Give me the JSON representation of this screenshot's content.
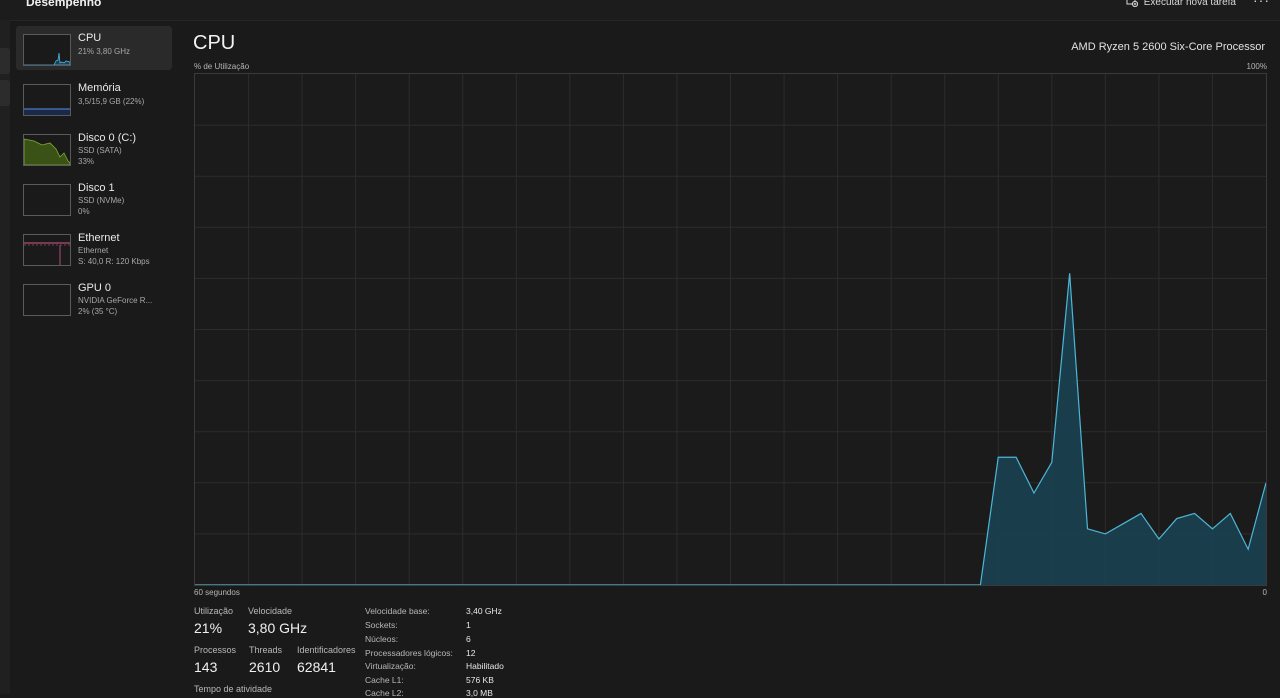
{
  "header": {
    "title": "Desempenho",
    "run_task_label": "Executar nova tarefa",
    "more_label": "···"
  },
  "sidebar": {
    "items": [
      {
        "name": "CPU",
        "sub1": "21% 3,80 GHz",
        "sub2": "",
        "sub3": "",
        "icon": "cpu-graph-icon",
        "color": "#4fb3e8"
      },
      {
        "name": "Memória",
        "sub1": "3,5/15,9 GB (22%)",
        "sub2": "",
        "sub3": "",
        "icon": "memory-graph-icon",
        "color": "#5b8fe0"
      },
      {
        "name": "Disco 0 (C:)",
        "sub1": "SSD (SATA)",
        "sub2": "33%",
        "sub3": "",
        "icon": "disk-graph-icon",
        "color": "#7fae2e"
      },
      {
        "name": "Disco 1",
        "sub1": "SSD (NVMe)",
        "sub2": "0%",
        "sub3": "",
        "icon": "disk-graph-icon",
        "color": "#7fae2e"
      },
      {
        "name": "Ethernet",
        "sub1": "Ethernet",
        "sub2": "S: 40,0  R: 120 Kbps",
        "sub3": "",
        "icon": "network-graph-icon",
        "color": "#d55a8a"
      },
      {
        "name": "GPU 0",
        "sub1": "NVIDIA GeForce R...",
        "sub2": "2% (35 °C)",
        "sub3": "",
        "icon": "gpu-graph-icon",
        "color": "#4fb3e8"
      }
    ]
  },
  "main": {
    "title": "CPU",
    "model": "AMD Ryzen 5 2600 Six-Core Processor",
    "y_label": "% de Utilização",
    "y_max_label": "100%",
    "x_left_label": "60 segundos",
    "x_right_label": "0"
  },
  "chart_data": {
    "type": "area",
    "title": "",
    "ylabel": "% de Utilização",
    "xlabel": "60 segundos",
    "x_range_seconds": [
      60,
      0
    ],
    "ylim": [
      0,
      100
    ],
    "grid": true,
    "colors": {
      "line": "#4fb6d8",
      "fill": "#1a4150"
    },
    "series": [
      {
        "x": [
          60,
          58,
          56,
          54,
          52,
          50,
          48,
          46,
          44,
          42,
          40,
          38,
          36,
          34,
          32,
          30,
          28,
          26,
          24,
          22,
          20,
          18,
          16,
          15,
          14,
          13,
          12,
          11,
          10,
          9,
          8,
          7,
          6,
          5,
          4,
          3,
          2,
          1,
          0
        ],
        "y": [
          0,
          0,
          0,
          0,
          0,
          0,
          0,
          0,
          0,
          0,
          0,
          0,
          0,
          0,
          0,
          0,
          0,
          0,
          0,
          0,
          0,
          0,
          0,
          25,
          25,
          18,
          24,
          61,
          11,
          10,
          12,
          14,
          9,
          13,
          14,
          11,
          14,
          7,
          20
        ]
      }
    ]
  },
  "stats": {
    "utilization_label": "Utilização",
    "utilization_value": "21%",
    "speed_label": "Velocidade",
    "speed_value": "3,80 GHz",
    "processes_label": "Processos",
    "processes_value": "143",
    "threads_label": "Threads",
    "threads_value": "2610",
    "handles_label": "Identificadores",
    "handles_value": "62841",
    "uptime_label": "Tempo de atividade"
  },
  "specs": [
    {
      "key": "Velocidade base:",
      "value": "3,40 GHz"
    },
    {
      "key": "Sockets:",
      "value": "1"
    },
    {
      "key": "Núcleos:",
      "value": "6"
    },
    {
      "key": "Processadores lógicos:",
      "value": "12"
    },
    {
      "key": "Virtualização:",
      "value": "Habilitado"
    },
    {
      "key": "Cache L1:",
      "value": "576 KB"
    },
    {
      "key": "Cache L2:",
      "value": "3,0 MB"
    }
  ]
}
